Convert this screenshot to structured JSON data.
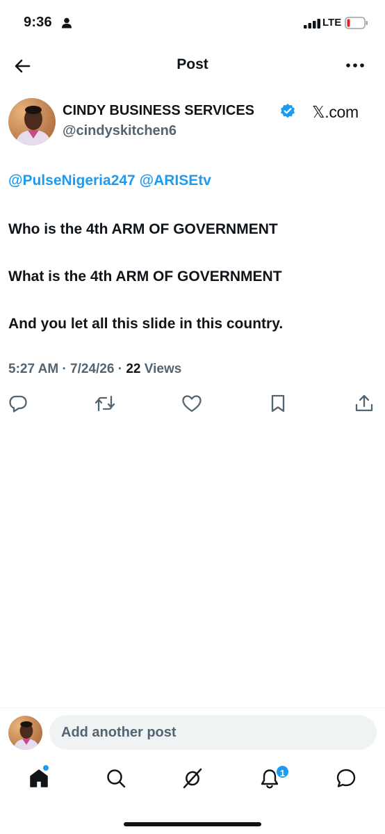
{
  "status_bar": {
    "time": "9:36",
    "network": "LTE",
    "person_icon": "person-icon",
    "signal_icon": "signal-bars-icon",
    "battery_icon": "battery-low-icon",
    "battery_color": "#e0242b"
  },
  "header": {
    "title": "Post",
    "back_icon": "arrow-left-icon",
    "more_icon": "more-horizontal-icon"
  },
  "post": {
    "author_name": "CINDY BUSINESS SERVICES",
    "verified_icon": "verified-badge-icon",
    "author_handle": "@cindyskitchen6",
    "source_watermark": "𝕏.com",
    "mentions": [
      "@PulseNigeria247",
      "@ARISEtv"
    ],
    "paragraphs": [
      "Who is the 4th ARM OF GOVERNMENT",
      "What is the 4th ARM OF GOVERNMENT",
      "And you let all this slide in this country."
    ],
    "time": "5:27 AM",
    "date": "7/24/26",
    "separator": "·",
    "views_count": "22",
    "views_label": "Views"
  },
  "actions": [
    {
      "name": "reply-icon"
    },
    {
      "name": "repost-icon"
    },
    {
      "name": "like-icon"
    },
    {
      "name": "bookmark-icon"
    },
    {
      "name": "share-icon"
    }
  ],
  "composer": {
    "placeholder": "Add another post"
  },
  "tab_bar": {
    "tabs": [
      "home-icon",
      "search-icon",
      "grok-icon",
      "notifications-icon",
      "messages-icon"
    ],
    "notification_badge": "1"
  },
  "colors": {
    "accent": "#1d9bf0",
    "text_primary": "#0f1419",
    "text_secondary": "#536471",
    "composer_bg": "#eff3f4"
  }
}
